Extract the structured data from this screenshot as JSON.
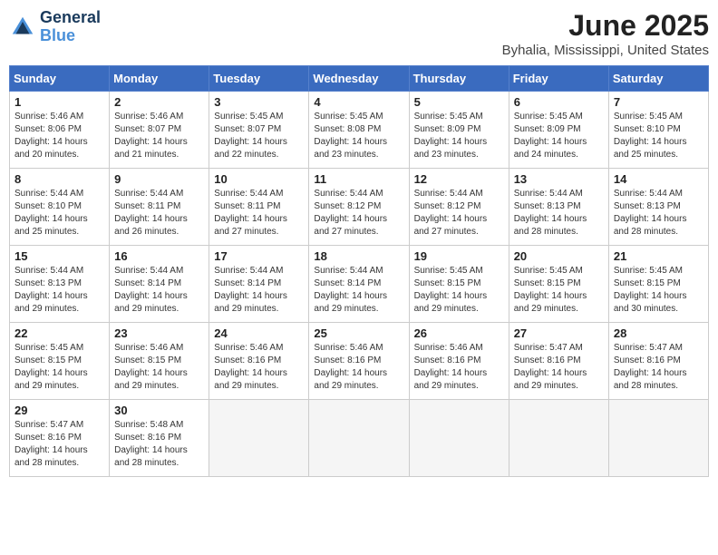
{
  "header": {
    "logo_line1": "General",
    "logo_line2": "Blue",
    "title": "June 2025",
    "subtitle": "Byhalia, Mississippi, United States"
  },
  "days_of_week": [
    "Sunday",
    "Monday",
    "Tuesday",
    "Wednesday",
    "Thursday",
    "Friday",
    "Saturday"
  ],
  "weeks": [
    [
      {
        "num": "1",
        "info": "Sunrise: 5:46 AM\nSunset: 8:06 PM\nDaylight: 14 hours\nand 20 minutes."
      },
      {
        "num": "2",
        "info": "Sunrise: 5:46 AM\nSunset: 8:07 PM\nDaylight: 14 hours\nand 21 minutes."
      },
      {
        "num": "3",
        "info": "Sunrise: 5:45 AM\nSunset: 8:07 PM\nDaylight: 14 hours\nand 22 minutes."
      },
      {
        "num": "4",
        "info": "Sunrise: 5:45 AM\nSunset: 8:08 PM\nDaylight: 14 hours\nand 23 minutes."
      },
      {
        "num": "5",
        "info": "Sunrise: 5:45 AM\nSunset: 8:09 PM\nDaylight: 14 hours\nand 23 minutes."
      },
      {
        "num": "6",
        "info": "Sunrise: 5:45 AM\nSunset: 8:09 PM\nDaylight: 14 hours\nand 24 minutes."
      },
      {
        "num": "7",
        "info": "Sunrise: 5:45 AM\nSunset: 8:10 PM\nDaylight: 14 hours\nand 25 minutes."
      }
    ],
    [
      {
        "num": "8",
        "info": "Sunrise: 5:44 AM\nSunset: 8:10 PM\nDaylight: 14 hours\nand 25 minutes."
      },
      {
        "num": "9",
        "info": "Sunrise: 5:44 AM\nSunset: 8:11 PM\nDaylight: 14 hours\nand 26 minutes."
      },
      {
        "num": "10",
        "info": "Sunrise: 5:44 AM\nSunset: 8:11 PM\nDaylight: 14 hours\nand 27 minutes."
      },
      {
        "num": "11",
        "info": "Sunrise: 5:44 AM\nSunset: 8:12 PM\nDaylight: 14 hours\nand 27 minutes."
      },
      {
        "num": "12",
        "info": "Sunrise: 5:44 AM\nSunset: 8:12 PM\nDaylight: 14 hours\nand 27 minutes."
      },
      {
        "num": "13",
        "info": "Sunrise: 5:44 AM\nSunset: 8:13 PM\nDaylight: 14 hours\nand 28 minutes."
      },
      {
        "num": "14",
        "info": "Sunrise: 5:44 AM\nSunset: 8:13 PM\nDaylight: 14 hours\nand 28 minutes."
      }
    ],
    [
      {
        "num": "15",
        "info": "Sunrise: 5:44 AM\nSunset: 8:13 PM\nDaylight: 14 hours\nand 29 minutes."
      },
      {
        "num": "16",
        "info": "Sunrise: 5:44 AM\nSunset: 8:14 PM\nDaylight: 14 hours\nand 29 minutes."
      },
      {
        "num": "17",
        "info": "Sunrise: 5:44 AM\nSunset: 8:14 PM\nDaylight: 14 hours\nand 29 minutes."
      },
      {
        "num": "18",
        "info": "Sunrise: 5:44 AM\nSunset: 8:14 PM\nDaylight: 14 hours\nand 29 minutes."
      },
      {
        "num": "19",
        "info": "Sunrise: 5:45 AM\nSunset: 8:15 PM\nDaylight: 14 hours\nand 29 minutes."
      },
      {
        "num": "20",
        "info": "Sunrise: 5:45 AM\nSunset: 8:15 PM\nDaylight: 14 hours\nand 29 minutes."
      },
      {
        "num": "21",
        "info": "Sunrise: 5:45 AM\nSunset: 8:15 PM\nDaylight: 14 hours\nand 30 minutes."
      }
    ],
    [
      {
        "num": "22",
        "info": "Sunrise: 5:45 AM\nSunset: 8:15 PM\nDaylight: 14 hours\nand 29 minutes."
      },
      {
        "num": "23",
        "info": "Sunrise: 5:46 AM\nSunset: 8:15 PM\nDaylight: 14 hours\nand 29 minutes."
      },
      {
        "num": "24",
        "info": "Sunrise: 5:46 AM\nSunset: 8:16 PM\nDaylight: 14 hours\nand 29 minutes."
      },
      {
        "num": "25",
        "info": "Sunrise: 5:46 AM\nSunset: 8:16 PM\nDaylight: 14 hours\nand 29 minutes."
      },
      {
        "num": "26",
        "info": "Sunrise: 5:46 AM\nSunset: 8:16 PM\nDaylight: 14 hours\nand 29 minutes."
      },
      {
        "num": "27",
        "info": "Sunrise: 5:47 AM\nSunset: 8:16 PM\nDaylight: 14 hours\nand 29 minutes."
      },
      {
        "num": "28",
        "info": "Sunrise: 5:47 AM\nSunset: 8:16 PM\nDaylight: 14 hours\nand 28 minutes."
      }
    ],
    [
      {
        "num": "29",
        "info": "Sunrise: 5:47 AM\nSunset: 8:16 PM\nDaylight: 14 hours\nand 28 minutes."
      },
      {
        "num": "30",
        "info": "Sunrise: 5:48 AM\nSunset: 8:16 PM\nDaylight: 14 hours\nand 28 minutes."
      },
      {
        "num": "",
        "info": ""
      },
      {
        "num": "",
        "info": ""
      },
      {
        "num": "",
        "info": ""
      },
      {
        "num": "",
        "info": ""
      },
      {
        "num": "",
        "info": ""
      }
    ]
  ]
}
